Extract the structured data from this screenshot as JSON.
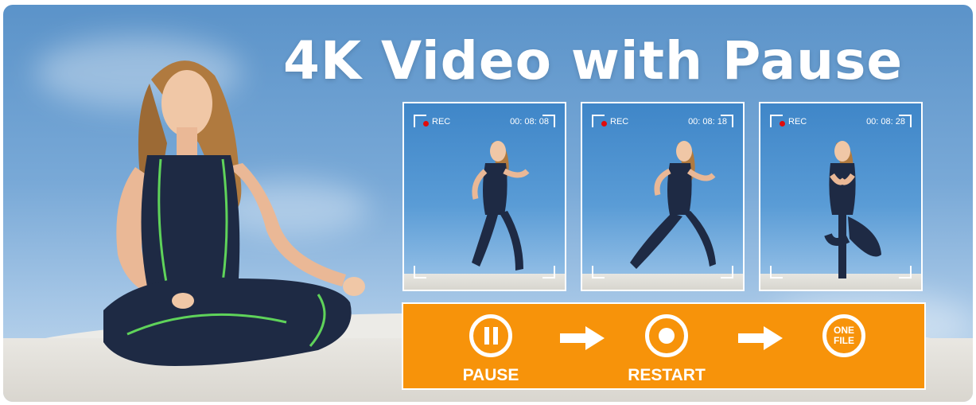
{
  "headline": "4K Video with Pause",
  "frames": [
    {
      "rec": "REC",
      "time": "00: 08: 08"
    },
    {
      "rec": "REC",
      "time": "00: 08: 18"
    },
    {
      "rec": "REC",
      "time": "00: 08: 28"
    }
  ],
  "steps": {
    "pause_label": "PAUSE",
    "restart_label": "RESTART",
    "one_file_line1": "ONE",
    "one_file_line2": "FILE"
  },
  "colors": {
    "orange": "#f7930a",
    "rec_red": "#e10b0b",
    "outfit": "#1e2a44",
    "outfit_stripe": "#5fd35a"
  }
}
